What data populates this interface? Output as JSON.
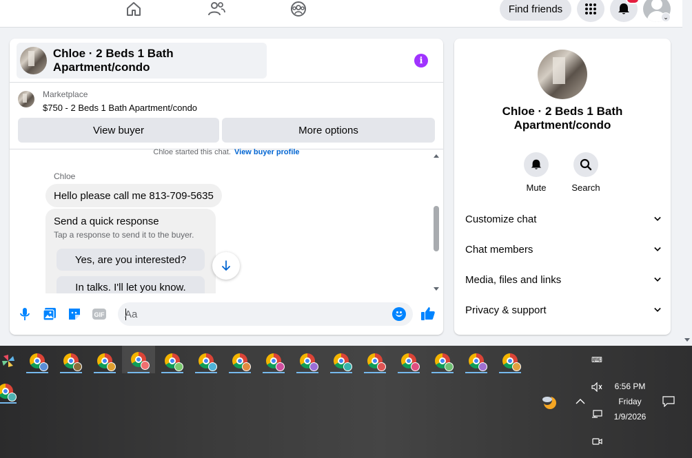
{
  "topbar": {
    "find_friends": "Find friends",
    "icons": [
      "home-icon",
      "friends-icon",
      "groups-icon",
      "menu-grid-icon",
      "notifications-icon",
      "account-avatar"
    ]
  },
  "chat": {
    "title": "Chloe · 2 Beds 1 Bath Apartment/condo",
    "listing": {
      "source": "Marketplace",
      "title": "$750 - 2 Beds 1 Bath Apartment/condo",
      "view_buyer": "View buyer",
      "more_options": "More options"
    },
    "system": {
      "text": "Chloe started this chat.",
      "link": "View buyer profile"
    },
    "sender": "Chloe",
    "message": "Hello please call me 813-709-5635",
    "quick_response": {
      "title": "Send a quick response",
      "subtitle": "Tap a response to send it to the buyer.",
      "options": [
        "Yes, are you interested?",
        "In talks. I'll let you know."
      ]
    },
    "composer": {
      "placeholder": "Aa"
    }
  },
  "details": {
    "name": "Chloe · 2 Beds 1 Bath Apartment/condo",
    "actions": [
      "Mute",
      "Search"
    ],
    "sections": [
      "Customize chat",
      "Chat members",
      "Media, files and links",
      "Privacy & support"
    ]
  },
  "taskbar": {
    "time": "6:56 PM",
    "day": "Friday",
    "date": "1/9/2026"
  },
  "colors": {
    "accent": "#0084ff",
    "info": "#a033ff",
    "badge": "#e41e3f"
  }
}
